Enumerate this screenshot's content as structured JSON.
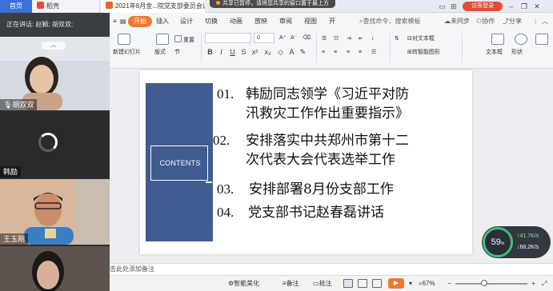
{
  "tabbar": {
    "home": "首页",
    "docer": "稻壳",
    "doc_title": "2021年8月金...院党支部委员会议",
    "share_banner": "共享已暂停，请将您共享的窗口置于最上方",
    "visitor_login": "访客登录"
  },
  "ribbon_tabs": {
    "items": [
      "开始",
      "插入",
      "设计",
      "切换",
      "动画",
      "放映",
      "审阅",
      "视图",
      "开"
    ],
    "active": "开始",
    "search": "查找命令、搜索模板",
    "not_synced": "未同步",
    "collaborate": "协作",
    "share": "分享"
  },
  "ribbon": {
    "new_slide": "新建幻灯片",
    "layout": "版式",
    "section": "节",
    "reset": "重置",
    "font_value": "",
    "size_value": "0",
    "text_box_right": "对文本框",
    "convert_smartart": "转智能图形",
    "textbox": "文本框",
    "shape": "形状"
  },
  "video": {
    "speaking": "正在讲话: 赵颖; 胡双双;",
    "tiles": [
      {
        "name": "胡双双"
      },
      {
        "name": "韩励"
      },
      {
        "name": "王玉刚"
      },
      {
        "name": ""
      }
    ]
  },
  "slide": {
    "contents_label": "CONTENTS",
    "items": [
      {
        "num": "01.",
        "line1": "韩励同志领学《习近平对防",
        "line2": "汛救灾工作作出重要指示》"
      },
      {
        "num": "02.",
        "line1": "安排落实中共郑州市第十二",
        "line2": "次代表大会代表选举工作"
      },
      {
        "num": "03.",
        "line1": "安排部署8月份支部工作"
      },
      {
        "num": "04.",
        "line1": "党支部书记赵春磊讲话"
      }
    ]
  },
  "perf": {
    "percent": "59",
    "unit": "%",
    "upload": "41.7K/s",
    "download": "68.2K/s"
  },
  "notes": {
    "placeholder": "击此处添加备注"
  },
  "status": {
    "smart_beautify": "智能美化",
    "notes": "备注",
    "comments": "批注",
    "zoom": "67%"
  },
  "colors": {
    "accent": "#f07830",
    "sidebar_blue": "#3f5b8f",
    "home_tab": "#3d6fd8",
    "visitor": "#e84a36"
  }
}
